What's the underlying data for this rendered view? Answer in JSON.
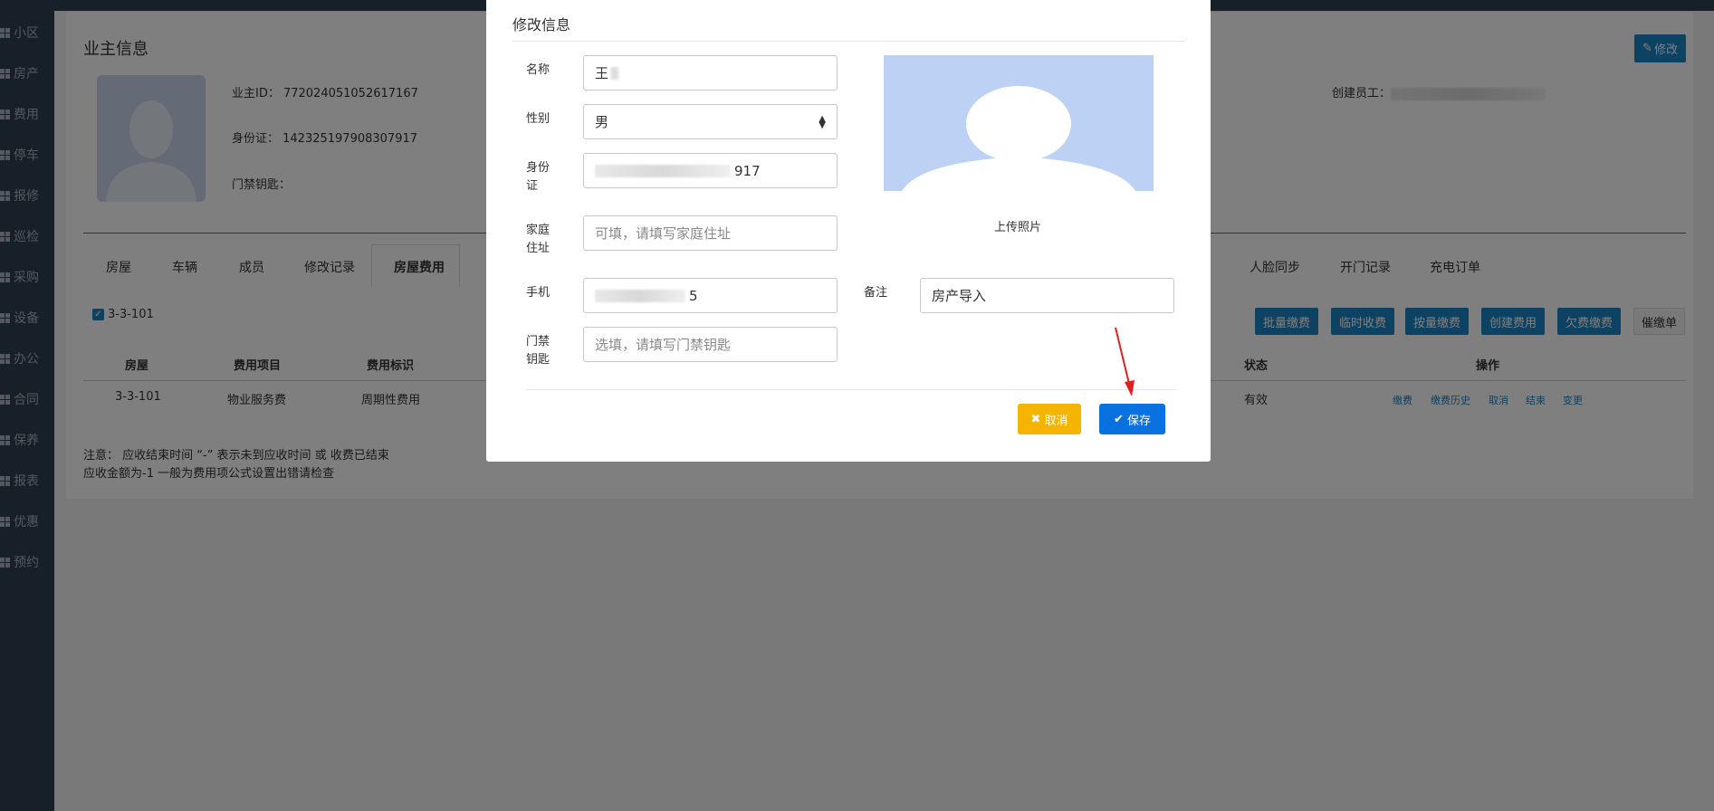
{
  "sidebar": {
    "items": [
      "小区",
      "房产",
      "费用",
      "停车",
      "报修",
      "巡检",
      "采购",
      "设备",
      "办公",
      "合同",
      "保养",
      "报表",
      "优惠",
      "预约"
    ]
  },
  "owner": {
    "title": "业主信息",
    "edit_label": "修改",
    "id_line": "业主ID：  772024051052617167",
    "idcard_line": "身份证：  142325197908307917",
    "key_line": "门禁钥匙：",
    "creator_line": "创建员工："
  },
  "tabs": [
    "房屋",
    "车辆",
    "成员",
    "修改记录",
    "房屋费用",
    "人脸同步",
    "开门记录",
    "充电订单"
  ],
  "room_check": "3-3-101",
  "actions": [
    "批量缴费",
    "临时收费",
    "按量缴费",
    "创建费用",
    "欠费缴费",
    "催缴单"
  ],
  "table": {
    "headers": [
      "房屋",
      "费用项目",
      "费用标识",
      "状态",
      "操作"
    ],
    "row": [
      "3-3-101",
      "物业服务费",
      "周期性费用",
      "有效"
    ],
    "ops": [
      "缴费",
      "缴费历史",
      "取消",
      "结束",
      "变更"
    ]
  },
  "notes": [
    "注意：  应收结束时间 “-” 表示未到应收时间 或 收费已结束",
    "应收金额为-1 一般为费用项公式设置出错请检查"
  ],
  "modal": {
    "title": "修改信息",
    "name_label": "名称",
    "name_value": "王",
    "gender_label": "性别",
    "gender_value": "男",
    "idcard_label": "身份证",
    "idcard_value": "917",
    "address_label": "家庭住址",
    "address_placeholder": "可填，请填写家庭住址",
    "phone_label": "手机",
    "phone_value": "5",
    "remark_label": "备注",
    "remark_value": "房产导入",
    "key_label": "门禁钥匙",
    "key_placeholder": "选填，请填写门禁钥匙",
    "upload_label": "上传照片",
    "cancel_label": "取消",
    "save_label": "保存"
  },
  "colors": {
    "primary": "#1c84c6",
    "save": "#0a72e0",
    "cancel": "#f5b400",
    "arrow": "#e02020"
  }
}
